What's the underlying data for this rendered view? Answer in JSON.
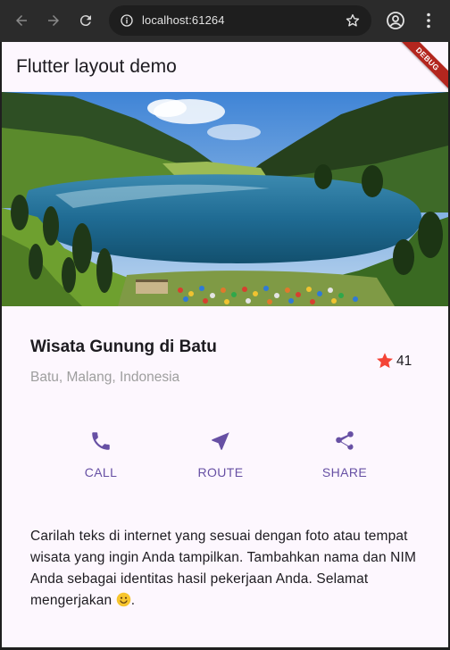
{
  "browser": {
    "url": "localhost:61264",
    "icons": {
      "back": "arrow-left-icon",
      "forward": "arrow-right-icon",
      "reload": "reload-icon",
      "site_info": "info-icon",
      "bookmark": "star-outline-icon",
      "profile": "account-icon",
      "menu": "more-vert-icon"
    }
  },
  "app": {
    "title": "Flutter layout demo",
    "debug_banner": "DEBUG",
    "image": {
      "subject": "lake-with-mountains-and-tents"
    },
    "place": {
      "title": "Wisata Gunung di Batu",
      "location": "Batu, Malang, Indonesia",
      "rating": "41",
      "rating_icon": "star-icon"
    },
    "actions": [
      {
        "label": "CALL",
        "icon": "phone-icon"
      },
      {
        "label": "ROUTE",
        "icon": "near-me-icon"
      },
      {
        "label": "SHARE",
        "icon": "share-icon"
      }
    ],
    "description": "Carilah teks di internet yang sesuai dengan foto atau tempat wisata yang ingin Anda tampilkan. Tambahkan nama dan NIM Anda sebagai identitas hasil pekerjaan Anda. Selamat mengerjakan",
    "description_emoji": "smiling-face-icon",
    "description_tail": "."
  },
  "colors": {
    "primary": "#6750a4",
    "star": "#f44336",
    "background": "#fdf7fe",
    "debug": "#b3261e"
  }
}
